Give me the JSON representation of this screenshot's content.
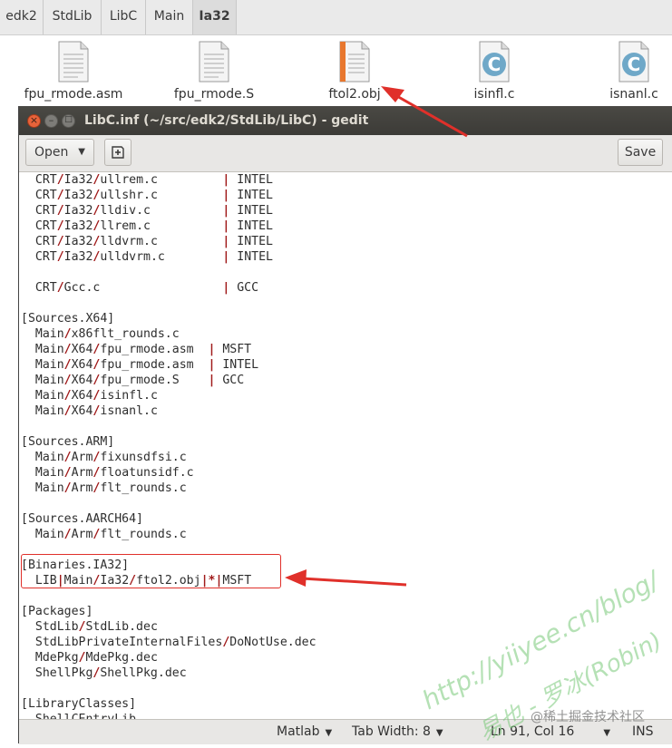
{
  "breadcrumb": {
    "items": [
      "edk2",
      "StdLib",
      "LibC",
      "Main",
      "Ia32"
    ]
  },
  "files": [
    {
      "name": "fpu_rmode.asm",
      "icon": "text-file-icon"
    },
    {
      "name": "fpu_rmode.S",
      "icon": "text-file-icon"
    },
    {
      "name": "ftol2.obj",
      "icon": "object-file-icon"
    },
    {
      "name": "isinfl.c",
      "icon": "c-source-file-icon"
    },
    {
      "name": "isnanl.c",
      "icon": "c-source-file-icon"
    }
  ],
  "window": {
    "title": "LibC.inf (~/src/edk2/StdLib/LibC) - gedit",
    "close_glyph": "×",
    "min_glyph": "–",
    "max_glyph": "□"
  },
  "toolbar": {
    "open_label": "Open",
    "save_label": "Save",
    "new_tab_icon": "new-document-icon"
  },
  "editor": {
    "lines": [
      [
        "  CRT",
        "/",
        "Ia32",
        "/",
        "ullrem.c         ",
        "|",
        " INTEL"
      ],
      [
        "  CRT",
        "/",
        "Ia32",
        "/",
        "ullshr.c         ",
        "|",
        " INTEL"
      ],
      [
        "  CRT",
        "/",
        "Ia32",
        "/",
        "lldiv.c          ",
        "|",
        " INTEL"
      ],
      [
        "  CRT",
        "/",
        "Ia32",
        "/",
        "llrem.c          ",
        "|",
        " INTEL"
      ],
      [
        "  CRT",
        "/",
        "Ia32",
        "/",
        "lldvrm.c         ",
        "|",
        " INTEL"
      ],
      [
        "  CRT",
        "/",
        "Ia32",
        "/",
        "ulldvrm.c        ",
        "|",
        " INTEL"
      ],
      [
        ""
      ],
      [
        "  CRT",
        "/",
        "Gcc.c                 ",
        "|",
        " GCC"
      ],
      [
        ""
      ],
      [
        "[Sources.X64]"
      ],
      [
        "  Main",
        "/",
        "x86flt_rounds.c"
      ],
      [
        "  Main",
        "/",
        "X64",
        "/",
        "fpu_rmode.asm  ",
        "|",
        " MSFT"
      ],
      [
        "  Main",
        "/",
        "X64",
        "/",
        "fpu_rmode.asm  ",
        "|",
        " INTEL"
      ],
      [
        "  Main",
        "/",
        "X64",
        "/",
        "fpu_rmode.S    ",
        "|",
        " GCC"
      ],
      [
        "  Main",
        "/",
        "X64",
        "/",
        "isinfl.c"
      ],
      [
        "  Main",
        "/",
        "X64",
        "/",
        "isnanl.c"
      ],
      [
        ""
      ],
      [
        "[Sources.ARM]"
      ],
      [
        "  Main",
        "/",
        "Arm",
        "/",
        "fixunsdfsi.c"
      ],
      [
        "  Main",
        "/",
        "Arm",
        "/",
        "floatunsidf.c"
      ],
      [
        "  Main",
        "/",
        "Arm",
        "/",
        "flt_rounds.c"
      ],
      [
        ""
      ],
      [
        "[Sources.AARCH64]"
      ],
      [
        "  Main",
        "/",
        "Arm",
        "/",
        "flt_rounds.c"
      ],
      [
        ""
      ],
      [
        "[Binaries.IA32]"
      ],
      [
        "  LIB",
        "|",
        "Main",
        "/",
        "Ia32",
        "/",
        "ftol2.obj",
        "|",
        "*",
        "|",
        "MSFT"
      ],
      [
        ""
      ],
      [
        "[Packages]"
      ],
      [
        "  StdLib",
        "/",
        "StdLib.dec"
      ],
      [
        "  StdLibPrivateInternalFiles",
        "/",
        "DoNotUse.dec"
      ],
      [
        "  MdePkg",
        "/",
        "MdePkg.dec"
      ],
      [
        "  ShellPkg",
        "/",
        "ShellPkg.dec"
      ],
      [
        ""
      ],
      [
        "[LibraryClasses]"
      ],
      [
        "  ShellCEntryLib"
      ]
    ]
  },
  "statusbar": {
    "language": "Matlab",
    "tab_width": "Tab Width: 8",
    "position": "Ln 91, Col 16",
    "mode": "INS"
  },
  "watermark": {
    "url": "http://yiiyee.cn/blog/",
    "author": "易也 - 罗冰(Robin)",
    "site": "@稀土掘金技术社区"
  },
  "colors": {
    "accent_red": "#e0302a",
    "separator_red": "#a01a1a",
    "titlebar": "#3c3b37"
  }
}
